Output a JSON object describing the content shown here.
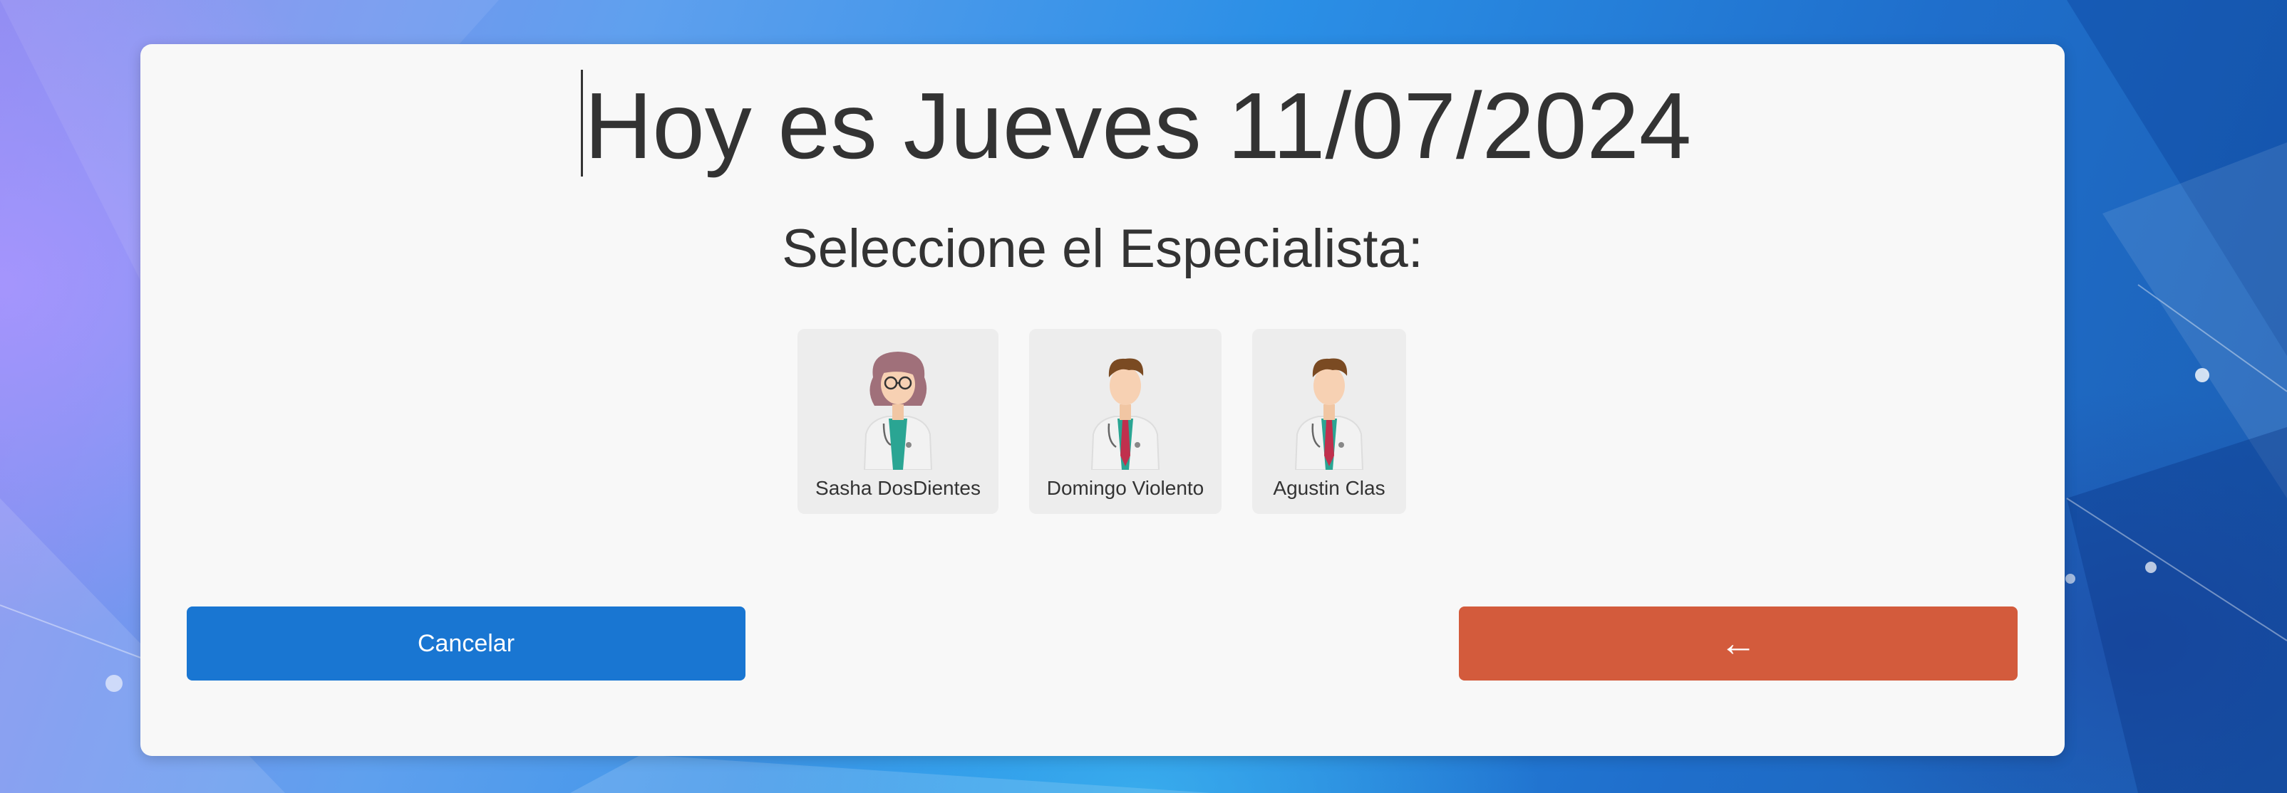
{
  "header": {
    "date_title": "Hoy es Jueves 11/07/2024"
  },
  "main": {
    "prompt": "Seleccione el Especialista:",
    "specialists": [
      {
        "name": "Sasha DosDientes",
        "avatar": "female-doctor-avatar"
      },
      {
        "name": "Domingo Violento",
        "avatar": "male-doctor-avatar"
      },
      {
        "name": "Agustin Clas",
        "avatar": "male-doctor-avatar"
      }
    ]
  },
  "actions": {
    "cancel_label": "Cancelar",
    "back_label": "←",
    "cancel_color": "#1976d2",
    "back_color": "#d35b3c"
  }
}
